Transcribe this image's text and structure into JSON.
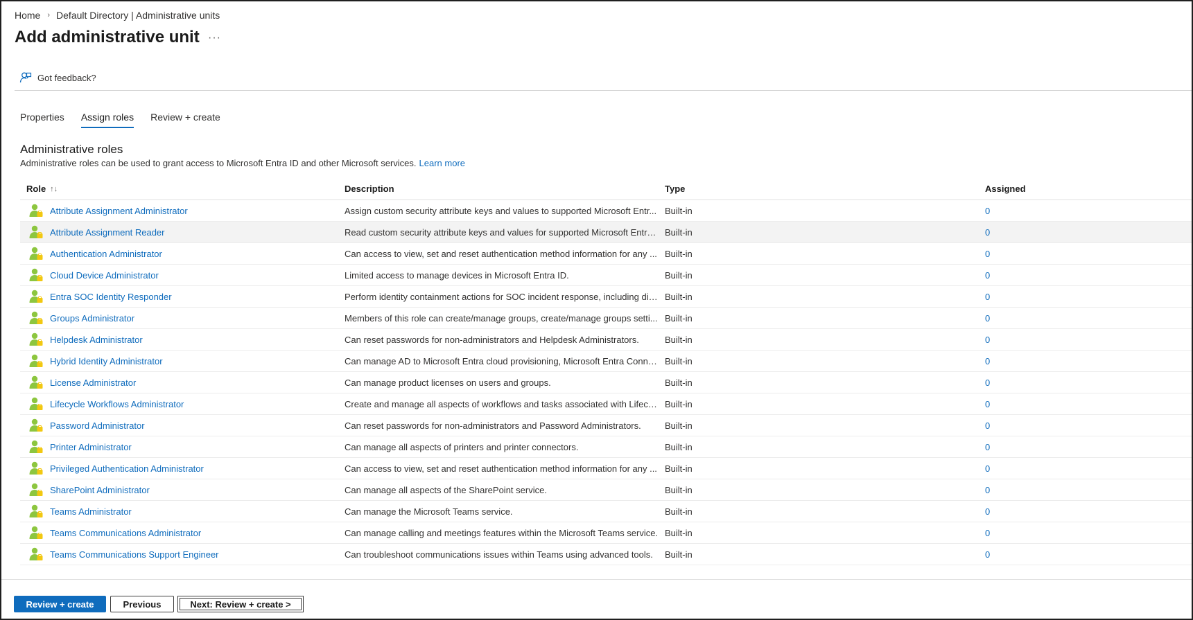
{
  "breadcrumb": {
    "home": "Home",
    "separator": "›",
    "current": "Default Directory | Administrative units"
  },
  "page": {
    "title": "Add administrative unit",
    "more": "···"
  },
  "feedback": {
    "label": "Got feedback?"
  },
  "tabs": [
    {
      "label": "Properties",
      "active": false
    },
    {
      "label": "Assign roles",
      "active": true
    },
    {
      "label": "Review + create",
      "active": false
    }
  ],
  "section": {
    "title": "Administrative roles",
    "description": "Administrative roles can be used to grant access to Microsoft Entra ID and other Microsoft services.",
    "learn_more": "Learn more"
  },
  "table": {
    "headers": {
      "role": "Role",
      "sort": "↑↓",
      "description": "Description",
      "type": "Type",
      "assigned": "Assigned"
    },
    "rows": [
      {
        "role": "Attribute Assignment Administrator",
        "description": "Assign custom security attribute keys and values to supported Microsoft Entr...",
        "type": "Built-in",
        "assigned": "0"
      },
      {
        "role": "Attribute Assignment Reader",
        "description": "Read custom security attribute keys and values for supported Microsoft Entra ...",
        "type": "Built-in",
        "assigned": "0"
      },
      {
        "role": "Authentication Administrator",
        "description": "Can access to view, set and reset authentication method information for any ...",
        "type": "Built-in",
        "assigned": "0"
      },
      {
        "role": "Cloud Device Administrator",
        "description": "Limited access to manage devices in Microsoft Entra ID.",
        "type": "Built-in",
        "assigned": "0"
      },
      {
        "role": "Entra SOC Identity Responder",
        "description": "Perform identity containment actions for SOC incident response, including dis...",
        "type": "Built-in",
        "assigned": "0"
      },
      {
        "role": "Groups Administrator",
        "description": "Members of this role can create/manage groups, create/manage groups setti...",
        "type": "Built-in",
        "assigned": "0"
      },
      {
        "role": "Helpdesk Administrator",
        "description": "Can reset passwords for non-administrators and Helpdesk Administrators.",
        "type": "Built-in",
        "assigned": "0"
      },
      {
        "role": "Hybrid Identity Administrator",
        "description": "Can manage AD to Microsoft Entra cloud provisioning, Microsoft Entra Conne...",
        "type": "Built-in",
        "assigned": "0"
      },
      {
        "role": "License Administrator",
        "description": "Can manage product licenses on users and groups.",
        "type": "Built-in",
        "assigned": "0"
      },
      {
        "role": "Lifecycle Workflows Administrator",
        "description": "Create and manage all aspects of workflows and tasks associated with Lifecycl...",
        "type": "Built-in",
        "assigned": "0"
      },
      {
        "role": "Password Administrator",
        "description": "Can reset passwords for non-administrators and Password Administrators.",
        "type": "Built-in",
        "assigned": "0"
      },
      {
        "role": "Printer Administrator",
        "description": "Can manage all aspects of printers and printer connectors.",
        "type": "Built-in",
        "assigned": "0"
      },
      {
        "role": "Privileged Authentication Administrator",
        "description": "Can access to view, set and reset authentication method information for any ...",
        "type": "Built-in",
        "assigned": "0"
      },
      {
        "role": "SharePoint Administrator",
        "description": "Can manage all aspects of the SharePoint service.",
        "type": "Built-in",
        "assigned": "0"
      },
      {
        "role": "Teams Administrator",
        "description": "Can manage the Microsoft Teams service.",
        "type": "Built-in",
        "assigned": "0"
      },
      {
        "role": "Teams Communications Administrator",
        "description": "Can manage calling and meetings features within the Microsoft Teams service.",
        "type": "Built-in",
        "assigned": "0"
      },
      {
        "role": "Teams Communications Support Engineer",
        "description": "Can troubleshoot communications issues within Teams using advanced tools.",
        "type": "Built-in",
        "assigned": "0"
      }
    ],
    "row_icon": "role-user-icon"
  },
  "footer": {
    "primary": "Review + create",
    "previous": "Previous",
    "next": "Next: Review + create >"
  },
  "colors": {
    "accent": "#0f6cbd",
    "icon_green": "#8dc63f",
    "icon_yellow": "#f2c811"
  }
}
